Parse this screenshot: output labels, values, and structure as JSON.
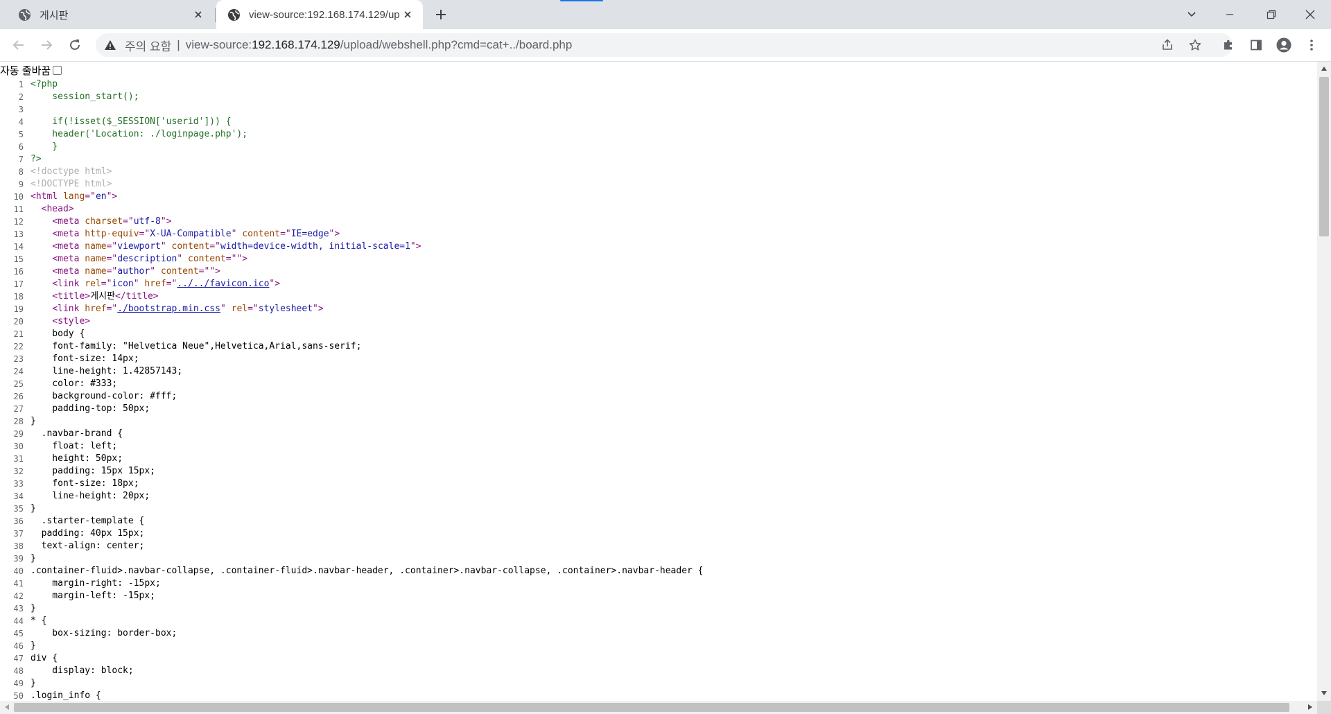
{
  "tabs": [
    {
      "title": "게시판",
      "icon": "globe-icon",
      "active": false
    },
    {
      "title": "view-source:192.168.174.129/up",
      "icon": "globe-icon",
      "active": true
    }
  ],
  "omnibox": {
    "security_label": "주의 요함",
    "divider": "|",
    "url_prefix": "view-source:",
    "url_host": "192.168.174.129",
    "url_path": "/upload/webshell.php?cmd=cat+../board.php"
  },
  "wrap_label": "자동 줄바꿈",
  "code_lines": [
    [
      [
        "php",
        "<?php"
      ]
    ],
    [
      [
        "php",
        "    session_start();"
      ]
    ],
    [],
    [
      [
        "php",
        "    if(!isset($_SESSION['userid'])) {"
      ]
    ],
    [
      [
        "php",
        "    header('Location: ./loginpage.php');"
      ]
    ],
    [
      [
        "php",
        "    }"
      ]
    ],
    [
      [
        "php",
        "?>"
      ]
    ],
    [
      [
        "cm",
        "<!doctype html>"
      ]
    ],
    [
      [
        "cm",
        "<!DOCTYPE html>"
      ]
    ],
    [
      [
        "tag",
        "<html "
      ],
      [
        "an",
        "lang"
      ],
      [
        "tag",
        "=\""
      ],
      [
        "av",
        "en"
      ],
      [
        "tag",
        "\">"
      ]
    ],
    [
      [
        "txt",
        "  "
      ],
      [
        "tag",
        "<head>"
      ]
    ],
    [
      [
        "txt",
        "    "
      ],
      [
        "tag",
        "<meta "
      ],
      [
        "an",
        "charset"
      ],
      [
        "tag",
        "=\""
      ],
      [
        "av",
        "utf-8"
      ],
      [
        "tag",
        "\">"
      ]
    ],
    [
      [
        "txt",
        "    "
      ],
      [
        "tag",
        "<meta "
      ],
      [
        "an",
        "http-equiv"
      ],
      [
        "tag",
        "=\""
      ],
      [
        "av",
        "X-UA-Compatible"
      ],
      [
        "tag",
        "\" "
      ],
      [
        "an",
        "content"
      ],
      [
        "tag",
        "=\""
      ],
      [
        "av",
        "IE=edge"
      ],
      [
        "tag",
        "\">"
      ]
    ],
    [
      [
        "txt",
        "    "
      ],
      [
        "tag",
        "<meta "
      ],
      [
        "an",
        "name"
      ],
      [
        "tag",
        "=\""
      ],
      [
        "av",
        "viewport"
      ],
      [
        "tag",
        "\" "
      ],
      [
        "an",
        "content"
      ],
      [
        "tag",
        "=\""
      ],
      [
        "av",
        "width=device-width, initial-scale=1"
      ],
      [
        "tag",
        "\">"
      ]
    ],
    [
      [
        "txt",
        "    "
      ],
      [
        "tag",
        "<meta "
      ],
      [
        "an",
        "name"
      ],
      [
        "tag",
        "=\""
      ],
      [
        "av",
        "description"
      ],
      [
        "tag",
        "\" "
      ],
      [
        "an",
        "content"
      ],
      [
        "tag",
        "=\"\">"
      ]
    ],
    [
      [
        "txt",
        "    "
      ],
      [
        "tag",
        "<meta "
      ],
      [
        "an",
        "name"
      ],
      [
        "tag",
        "=\""
      ],
      [
        "av",
        "author"
      ],
      [
        "tag",
        "\" "
      ],
      [
        "an",
        "content"
      ],
      [
        "tag",
        "=\"\">"
      ]
    ],
    [
      [
        "txt",
        "    "
      ],
      [
        "tag",
        "<link "
      ],
      [
        "an",
        "rel"
      ],
      [
        "tag",
        "=\""
      ],
      [
        "av",
        "icon"
      ],
      [
        "tag",
        "\" "
      ],
      [
        "an",
        "href"
      ],
      [
        "tag",
        "=\""
      ],
      [
        "lnk",
        "../../favicon.ico"
      ],
      [
        "tag",
        "\">"
      ]
    ],
    [
      [
        "txt",
        "    "
      ],
      [
        "tag",
        "<title>"
      ],
      [
        "txt",
        "게시판"
      ],
      [
        "tag",
        "</title>"
      ]
    ],
    [
      [
        "txt",
        "    "
      ],
      [
        "tag",
        "<link "
      ],
      [
        "an",
        "href"
      ],
      [
        "tag",
        "=\""
      ],
      [
        "lnk",
        "./bootstrap.min.css"
      ],
      [
        "tag",
        "\" "
      ],
      [
        "an",
        "rel"
      ],
      [
        "tag",
        "=\""
      ],
      [
        "av",
        "stylesheet"
      ],
      [
        "tag",
        "\">"
      ]
    ],
    [
      [
        "txt",
        "    "
      ],
      [
        "tag",
        "<style>"
      ]
    ],
    [
      [
        "txt",
        "    body {"
      ]
    ],
    [
      [
        "txt",
        "    font-family: \"Helvetica Neue\",Helvetica,Arial,sans-serif;"
      ]
    ],
    [
      [
        "txt",
        "    font-size: 14px;"
      ]
    ],
    [
      [
        "txt",
        "    line-height: 1.42857143;"
      ]
    ],
    [
      [
        "txt",
        "    color: #333;"
      ]
    ],
    [
      [
        "txt",
        "    background-color: #fff;"
      ]
    ],
    [
      [
        "txt",
        "    padding-top: 50px;"
      ]
    ],
    [
      [
        "txt",
        "}"
      ]
    ],
    [
      [
        "txt",
        "  .navbar-brand {"
      ]
    ],
    [
      [
        "txt",
        "    float: left;"
      ]
    ],
    [
      [
        "txt",
        "    height: 50px;"
      ]
    ],
    [
      [
        "txt",
        "    padding: 15px 15px;"
      ]
    ],
    [
      [
        "txt",
        "    font-size: 18px;"
      ]
    ],
    [
      [
        "txt",
        "    line-height: 20px;"
      ]
    ],
    [
      [
        "txt",
        "}"
      ]
    ],
    [
      [
        "txt",
        "  .starter-template {"
      ]
    ],
    [
      [
        "txt",
        "  padding: 40px 15px;"
      ]
    ],
    [
      [
        "txt",
        "  text-align: center;"
      ]
    ],
    [
      [
        "txt",
        "}"
      ]
    ],
    [
      [
        "txt",
        ".container-fluid>.navbar-collapse, .container-fluid>.navbar-header, .container>.navbar-collapse, .container>.navbar-header {"
      ]
    ],
    [
      [
        "txt",
        "    margin-right: -15px;"
      ]
    ],
    [
      [
        "txt",
        "    margin-left: -15px;"
      ]
    ],
    [
      [
        "txt",
        "}"
      ]
    ],
    [
      [
        "txt",
        "* {"
      ]
    ],
    [
      [
        "txt",
        "    box-sizing: border-box;"
      ]
    ],
    [
      [
        "txt",
        "}"
      ]
    ],
    [
      [
        "txt",
        "div {"
      ]
    ],
    [
      [
        "txt",
        "    display: block;"
      ]
    ],
    [
      [
        "txt",
        "}"
      ]
    ],
    [
      [
        "txt",
        ".login_info {"
      ]
    ]
  ]
}
